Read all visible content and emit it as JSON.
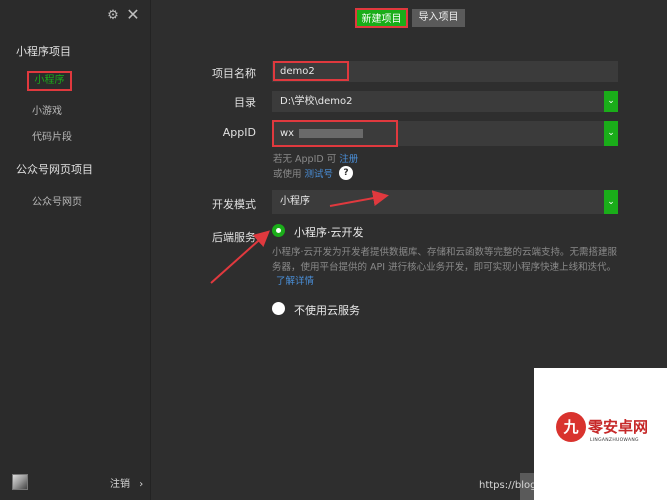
{
  "sidebar": {
    "sections": [
      {
        "title": "小程序项目",
        "items": [
          "小程序",
          "小游戏",
          "代码片段"
        ]
      },
      {
        "title": "公众号网页项目",
        "items": [
          "公众号网页"
        ]
      }
    ],
    "logout_label": "注销",
    "logout_arrow": "›"
  },
  "toolbar": {
    "new_project": "新建项目",
    "import_project": "导入项目"
  },
  "form": {
    "project_name_label": "项目名称",
    "project_name_value": "demo2",
    "directory_label": "目录",
    "directory_value": "D:\\学校\\demo2",
    "appid_label": "AppID",
    "appid_value": "wx",
    "appid_hint_prefix": "若无 AppID 可",
    "appid_hint_link": "注册",
    "test_hint_prefix": "或使用",
    "test_hint_link": "测试号",
    "help_glyph": "?",
    "dev_mode_label": "开发模式",
    "dev_mode_value": "小程序",
    "backend_label": "后端服务",
    "cloud_option": "小程序·云开发",
    "cloud_desc": "小程序·云开发为开发者提供数据库、存储和云函数等完整的云端支持。无需搭建服务器，使用平台提供的 API 进行核心业务开发，即可实现小程序快速上线和迭代。",
    "cloud_more_link": "了解详情",
    "no_cloud_option": "不使用云服务"
  },
  "watermark": {
    "logo_char": "九",
    "title": "零安卓网",
    "subtitle": "LINGANZHUOWANG"
  },
  "footer_url": "https://blog.c",
  "colors": {
    "accent": "#1aad19",
    "highlight": "#e0393e",
    "link": "#4a8fd8"
  }
}
